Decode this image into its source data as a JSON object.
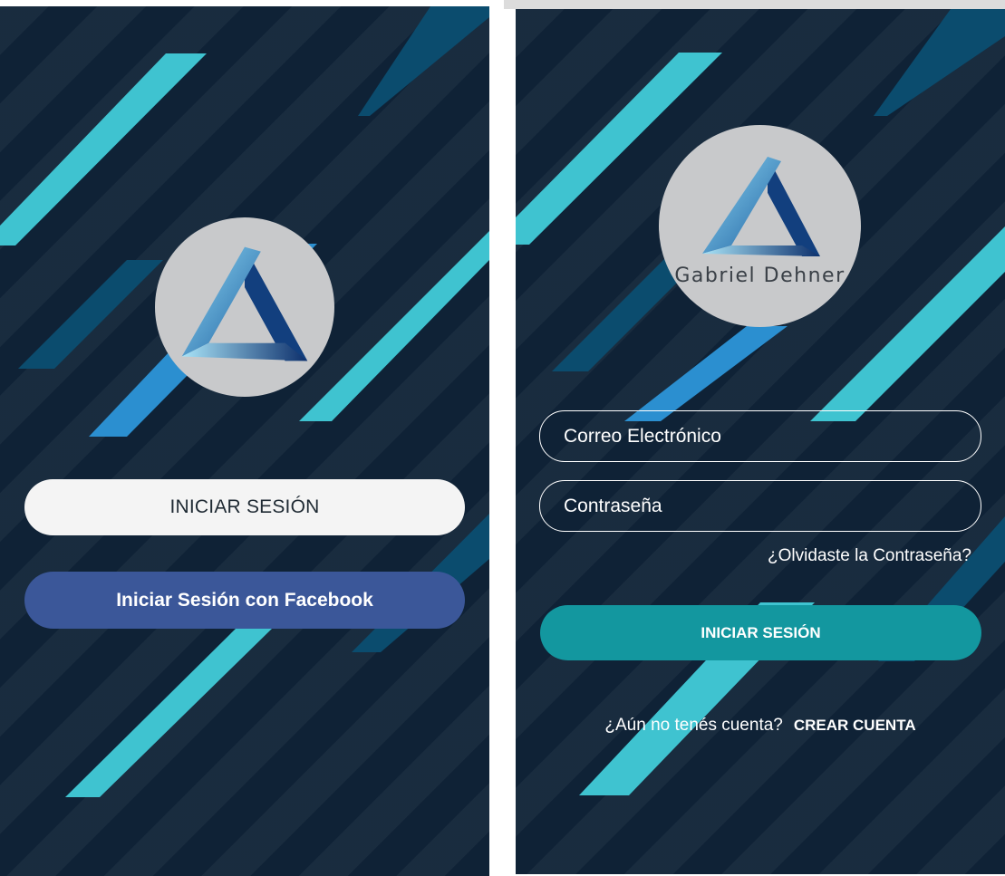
{
  "left_screen": {
    "login_button": "INICIAR SESIÓN",
    "facebook_button": "Iniciar Sesión con Facebook"
  },
  "right_screen": {
    "logo_text": "Gabriel Dehner",
    "email_placeholder": "Correo Electrónico",
    "password_placeholder": "Contraseña",
    "forgot_password": "¿Olvidaste la Contraseña?",
    "login_button": "INICIAR SESIÓN",
    "no_account_text": "¿Aún no tenés cuenta?",
    "create_account": "CREAR CUENTA"
  },
  "colors": {
    "background": "#0f2236",
    "stripe_light": "#3fc3d0",
    "stripe_mid": "#2b8fd0",
    "stripe_dark": "#0b4c6e",
    "facebook": "#3b5799",
    "teal": "#13979f",
    "logo_circle": "#c8c9cb"
  },
  "icons": [
    "triangle-logo-icon"
  ]
}
